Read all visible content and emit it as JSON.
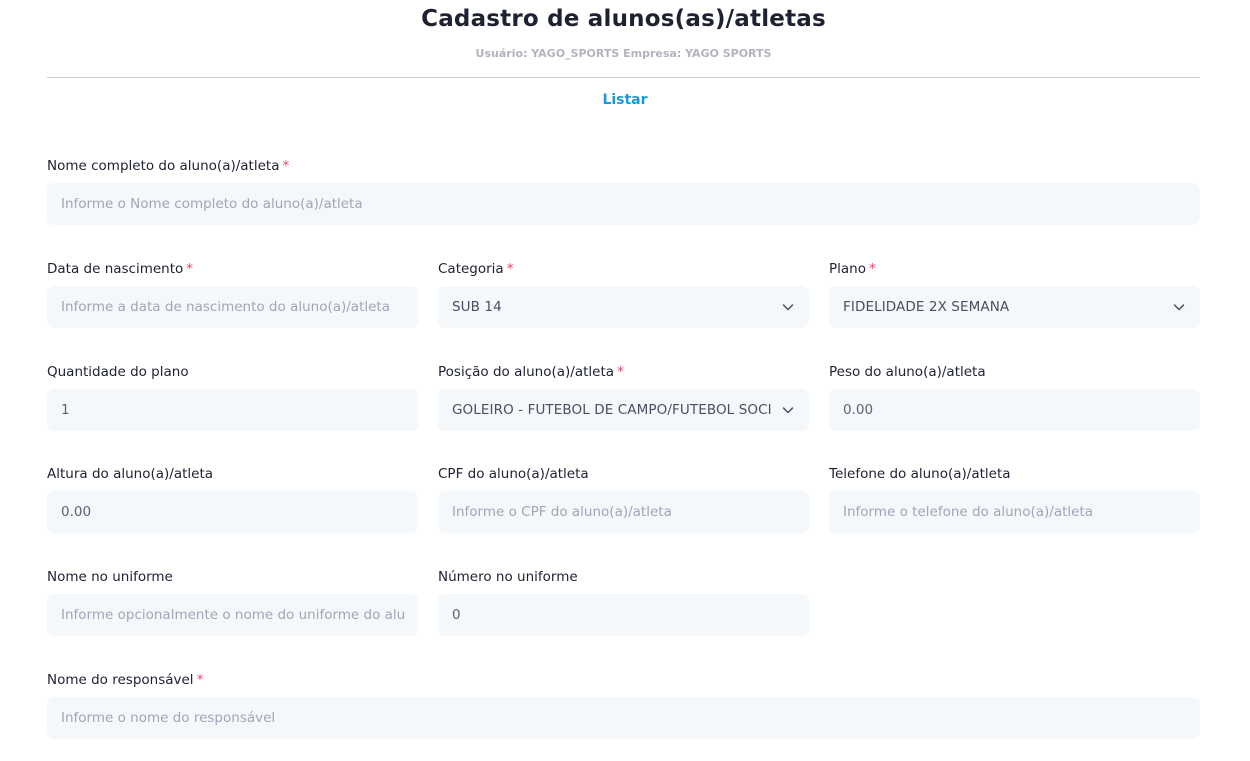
{
  "header": {
    "title": "Cadastro de alunos(as)/atletas",
    "subtitle": "Usuário: YAGO_SPORTS Empresa: YAGO SPORTS",
    "list_link": "Listar"
  },
  "required_marker": "*",
  "fields": {
    "nome_completo": {
      "label": "Nome completo do aluno(a)/atleta",
      "placeholder": "Informe o Nome completo do aluno(a)/atleta",
      "value": ""
    },
    "data_nascimento": {
      "label": "Data de nascimento",
      "placeholder": "Informe a data de nascimento do aluno(a)/atleta",
      "value": ""
    },
    "categoria": {
      "label": "Categoria",
      "selected": "SUB 14"
    },
    "plano": {
      "label": "Plano",
      "selected": "FIDELIDADE 2X SEMANA"
    },
    "quantidade_plano": {
      "label": "Quantidade do plano",
      "value": "1"
    },
    "posicao": {
      "label": "Posição do aluno(a)/atleta",
      "selected": "GOLEIRO - FUTEBOL DE CAMPO/FUTEBOL SOCIETY"
    },
    "peso": {
      "label": "Peso do aluno(a)/atleta",
      "value": "0.00"
    },
    "altura": {
      "label": "Altura do aluno(a)/atleta",
      "value": "0.00"
    },
    "cpf": {
      "label": "CPF do aluno(a)/atleta",
      "placeholder": "Informe o CPF do aluno(a)/atleta",
      "value": ""
    },
    "telefone": {
      "label": "Telefone do aluno(a)/atleta",
      "placeholder": "Informe o telefone do aluno(a)/atleta",
      "value": ""
    },
    "nome_uniforme": {
      "label": "Nome no uniforme",
      "placeholder": "Informe opcionalmente o nome do uniforme do aluno(a)/atleta",
      "value": ""
    },
    "numero_uniforme": {
      "label": "Número no uniforme",
      "value": "0"
    },
    "nome_responsavel": {
      "label": "Nome do responsável",
      "placeholder": "Informe o nome do responsável",
      "value": ""
    }
  },
  "icons": {
    "select_arrow": "chevron-down-icon"
  },
  "colors": {
    "accent": "#1b9ad6",
    "required": "#f1416c",
    "input_bg": "#f5f8fa"
  }
}
